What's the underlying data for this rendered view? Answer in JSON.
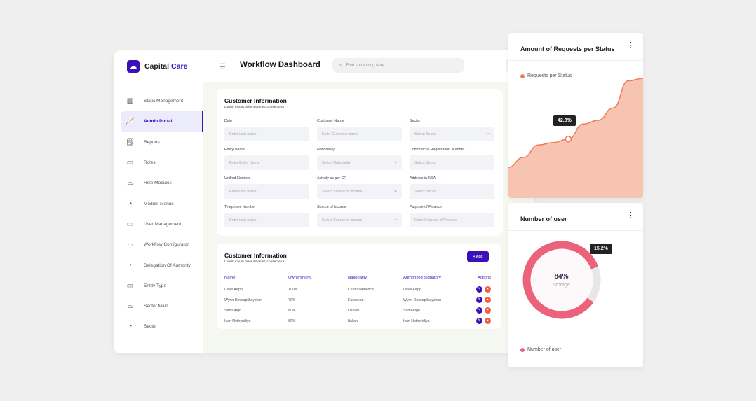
{
  "brand": {
    "name_part1": "Capital",
    "name_part2": "Care"
  },
  "sidebar": {
    "items": [
      {
        "label": "Static Management",
        "icon": "bar-chart-icon"
      },
      {
        "label": "Admin Portal",
        "icon": "trend-chart-icon",
        "active": true
      },
      {
        "label": "Reports",
        "icon": "calendar-note-icon"
      },
      {
        "label": "Roles",
        "icon": "calendar-icon"
      },
      {
        "label": "Role Modules",
        "icon": "cloche-icon"
      },
      {
        "label": "Module Menus",
        "icon": "pie-chart-icon"
      },
      {
        "label": "User Management",
        "icon": "calendar-icon"
      },
      {
        "label": "Workflow Configurator",
        "icon": "cloche-icon"
      },
      {
        "label": "Delegation Of Authority",
        "icon": "pie-chart-icon"
      },
      {
        "label": "Entity Type",
        "icon": "calendar-icon"
      },
      {
        "label": "Sector Main",
        "icon": "cloche-icon"
      },
      {
        "label": "Sector",
        "icon": "pie-chart-icon"
      }
    ]
  },
  "header": {
    "title": "Workflow Dashboard",
    "search_placeholder": "Find something here..."
  },
  "form": {
    "title": "Customer Information",
    "subtitle": "Lorem ipsum dolor sit amet, consectetur",
    "fields": [
      {
        "label": "Date",
        "placeholder": "Enter task name",
        "select": false
      },
      {
        "label": "Customer Name",
        "placeholder": "Enter Customer name",
        "select": false
      },
      {
        "label": "Sector",
        "placeholder": "Select Sector",
        "select": true
      },
      {
        "label": "Entity Name",
        "placeholder": "Enter Entity Name",
        "select": false
      },
      {
        "label": "Nationality",
        "placeholder": "Select Nationality",
        "select": true
      },
      {
        "label": "Commercial Registration Number",
        "placeholder": "Select Sector",
        "select": false
      },
      {
        "label": "Unified Number",
        "placeholder": "Enter task name",
        "select": false
      },
      {
        "label": "Activity as per CR",
        "placeholder": "Select Source of income",
        "select": true
      },
      {
        "label": "Address in KSA",
        "placeholder": "Select Sector",
        "select": false
      },
      {
        "label": "Telephone Number",
        "placeholder": "Enter task name",
        "select": false
      },
      {
        "label": "Source of Income",
        "placeholder": "Select Source of income",
        "select": true
      },
      {
        "label": "Purpose of Finance",
        "placeholder": "Enter Purpose of Finance",
        "select": false
      }
    ]
  },
  "table_card": {
    "title": "Customer Information",
    "subtitle": "Lorem ipsum dolor sit amet, consectetur",
    "add_label": "+ Add",
    "columns": [
      "Name",
      "Ownership%",
      "Nationality",
      "Authorized Signatory",
      "Actions"
    ],
    "rows": [
      [
        "Dave Allipp",
        "100%",
        "Central America",
        "Dave Allipp"
      ],
      [
        "Wynn Doosaplikayshun",
        "70%",
        "European",
        "Wynn Doosaplikayshun"
      ],
      [
        "Santi Argo",
        "80%",
        "Danish",
        "Santi Argo"
      ],
      [
        "Ivan Notheridiya",
        "60%",
        "Italian",
        "Ivan Notheridiya"
      ]
    ]
  },
  "chart_data": [
    {
      "type": "area",
      "title": "Amount of Requests per Status",
      "series": [
        {
          "name": "Requests per Status",
          "values": [
            20,
            28,
            38,
            40,
            42.8,
            55,
            58,
            68,
            90,
            92
          ]
        }
      ],
      "tooltip": "42.8%",
      "color": "#f07a55",
      "fill": "#f6c4b0",
      "grid": false,
      "legend": "top-left"
    },
    {
      "type": "pie",
      "title": "Number of user",
      "center_value": "84%",
      "center_label": "Storage",
      "tooltip": "15.2%",
      "series": [
        {
          "name": "Number of user",
          "values": [
            84,
            15.2
          ]
        }
      ],
      "colors": [
        "#eb627a",
        "#e8e6e8"
      ],
      "legend": "bottom-left"
    }
  ]
}
